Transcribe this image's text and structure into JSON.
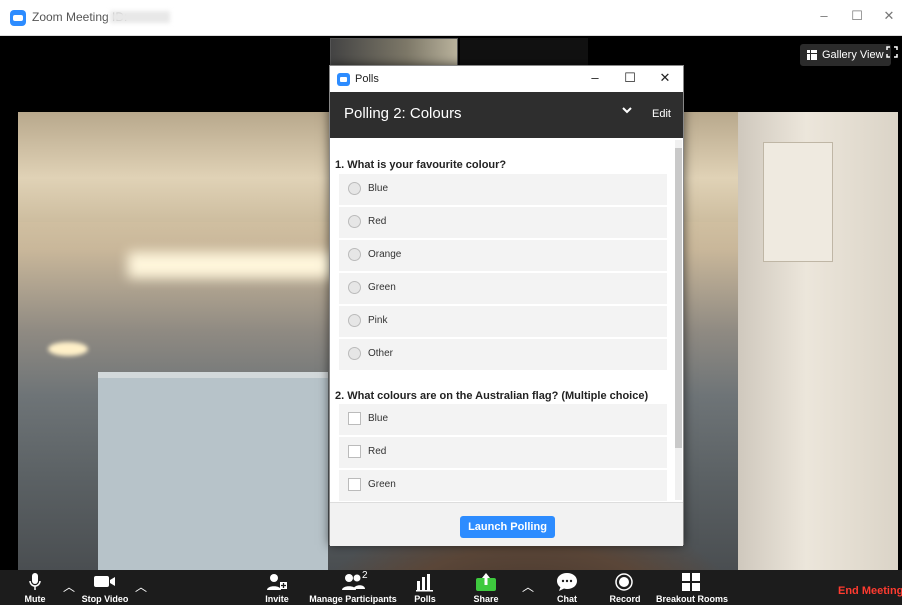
{
  "window": {
    "title": "Zoom Meeting ID:",
    "minimize": "–",
    "maximize": "☐",
    "close": "✕"
  },
  "stage": {
    "gallery_view": "Gallery View"
  },
  "polls_window": {
    "title": "Polls",
    "minimize": "–",
    "maximize": "☐",
    "close": "✕",
    "poll_name": "Polling 2: Colours",
    "edit": "Edit",
    "questions": [
      {
        "text": "1. What is your favourite colour?",
        "type": "single",
        "options": [
          "Blue",
          "Red",
          "Orange",
          "Green",
          "Pink",
          "Other"
        ]
      },
      {
        "text": "2. What colours are on the Australian flag? (Multiple choice)",
        "type": "multiple",
        "options": [
          "Blue",
          "Red",
          "Green"
        ]
      }
    ],
    "launch_button": "Launch Polling"
  },
  "toolbar": {
    "mute": "Mute",
    "stop_video": "Stop Video",
    "invite": "Invite",
    "manage_participants": "Manage Participants",
    "participants_count": "2",
    "polls": "Polls",
    "share": "Share",
    "chat": "Chat",
    "record": "Record",
    "breakout_rooms": "Breakout Rooms",
    "end_meeting": "End Meeting"
  },
  "colors": {
    "accent": "#2d8cff",
    "share_green": "#3ec93e",
    "end_meeting_red": "#ff3b30",
    "poll_header_bg": "#2e2e2e"
  }
}
